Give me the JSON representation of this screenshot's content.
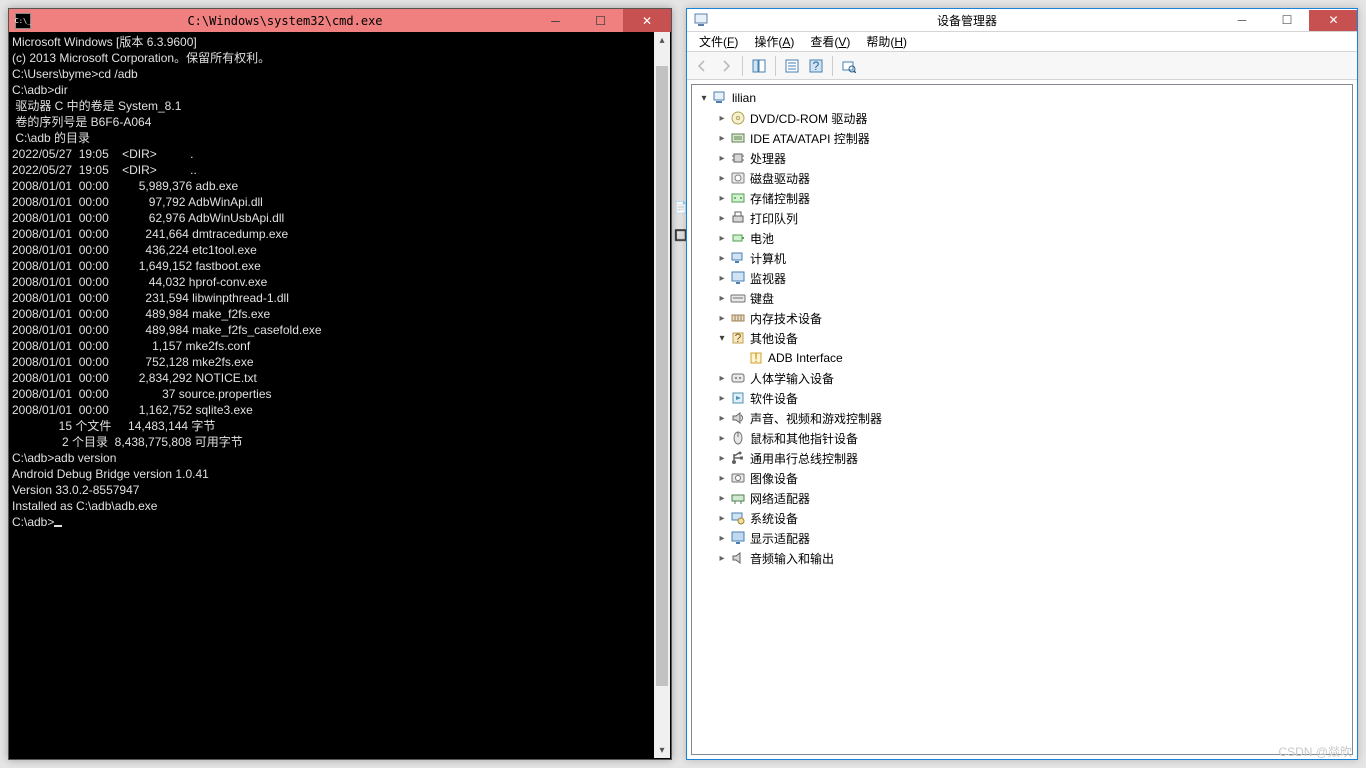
{
  "cmd": {
    "title": "C:\\Windows\\system32\\cmd.exe",
    "lines": [
      "Microsoft Windows [版本 6.3.9600]",
      "(c) 2013 Microsoft Corporation。保留所有权利。",
      "",
      "C:\\Users\\byme>cd /adb",
      "",
      "C:\\adb>dir",
      " 驱动器 C 中的卷是 System_8.1",
      " 卷的序列号是 B6F6-A064",
      "",
      " C:\\adb 的目录",
      "",
      "2022/05/27  19:05    <DIR>          .",
      "2022/05/27  19:05    <DIR>          ..",
      "2008/01/01  00:00         5,989,376 adb.exe",
      "2008/01/01  00:00            97,792 AdbWinApi.dll",
      "2008/01/01  00:00            62,976 AdbWinUsbApi.dll",
      "2008/01/01  00:00           241,664 dmtracedump.exe",
      "2008/01/01  00:00           436,224 etc1tool.exe",
      "2008/01/01  00:00         1,649,152 fastboot.exe",
      "2008/01/01  00:00            44,032 hprof-conv.exe",
      "2008/01/01  00:00           231,594 libwinpthread-1.dll",
      "2008/01/01  00:00           489,984 make_f2fs.exe",
      "2008/01/01  00:00           489,984 make_f2fs_casefold.exe",
      "2008/01/01  00:00             1,157 mke2fs.conf",
      "2008/01/01  00:00           752,128 mke2fs.exe",
      "2008/01/01  00:00         2,834,292 NOTICE.txt",
      "2008/01/01  00:00                37 source.properties",
      "2008/01/01  00:00         1,162,752 sqlite3.exe",
      "              15 个文件     14,483,144 字节",
      "               2 个目录  8,438,775,808 可用字节",
      "",
      "C:\\adb>adb version",
      "Android Debug Bridge version 1.0.41",
      "Version 33.0.2-8557947",
      "Installed as C:\\adb\\adb.exe",
      "",
      "C:\\adb>"
    ]
  },
  "dm": {
    "title": "设备管理器",
    "menus": [
      {
        "label": "文件",
        "key": "F"
      },
      {
        "label": "操作",
        "key": "A"
      },
      {
        "label": "查看",
        "key": "V"
      },
      {
        "label": "帮助",
        "key": "H"
      }
    ],
    "root": "lilian",
    "nodes": [
      {
        "icon": "disc",
        "label": "DVD/CD-ROM 驱动器"
      },
      {
        "icon": "ide",
        "label": "IDE ATA/ATAPI 控制器"
      },
      {
        "icon": "cpu",
        "label": "处理器"
      },
      {
        "icon": "hdd",
        "label": "磁盘驱动器"
      },
      {
        "icon": "storage",
        "label": "存储控制器"
      },
      {
        "icon": "printer",
        "label": "打印队列"
      },
      {
        "icon": "battery",
        "label": "电池"
      },
      {
        "icon": "computer",
        "label": "计算机"
      },
      {
        "icon": "monitor",
        "label": "监视器"
      },
      {
        "icon": "keyboard",
        "label": "键盘"
      },
      {
        "icon": "memory",
        "label": "内存技术设备"
      },
      {
        "icon": "other",
        "label": "其他设备",
        "open": true,
        "children": [
          {
            "icon": "unknown",
            "label": "ADB Interface"
          }
        ]
      },
      {
        "icon": "hid",
        "label": "人体学输入设备"
      },
      {
        "icon": "software",
        "label": "软件设备"
      },
      {
        "icon": "sound",
        "label": "声音、视频和游戏控制器"
      },
      {
        "icon": "mouse",
        "label": "鼠标和其他指针设备"
      },
      {
        "icon": "usb",
        "label": "通用串行总线控制器"
      },
      {
        "icon": "imaging",
        "label": "图像设备"
      },
      {
        "icon": "network",
        "label": "网络适配器"
      },
      {
        "icon": "system",
        "label": "系统设备"
      },
      {
        "icon": "display",
        "label": "显示适配器"
      },
      {
        "icon": "audio",
        "label": "音频输入和输出"
      }
    ]
  },
  "watermark": "CSDN @燚欥"
}
